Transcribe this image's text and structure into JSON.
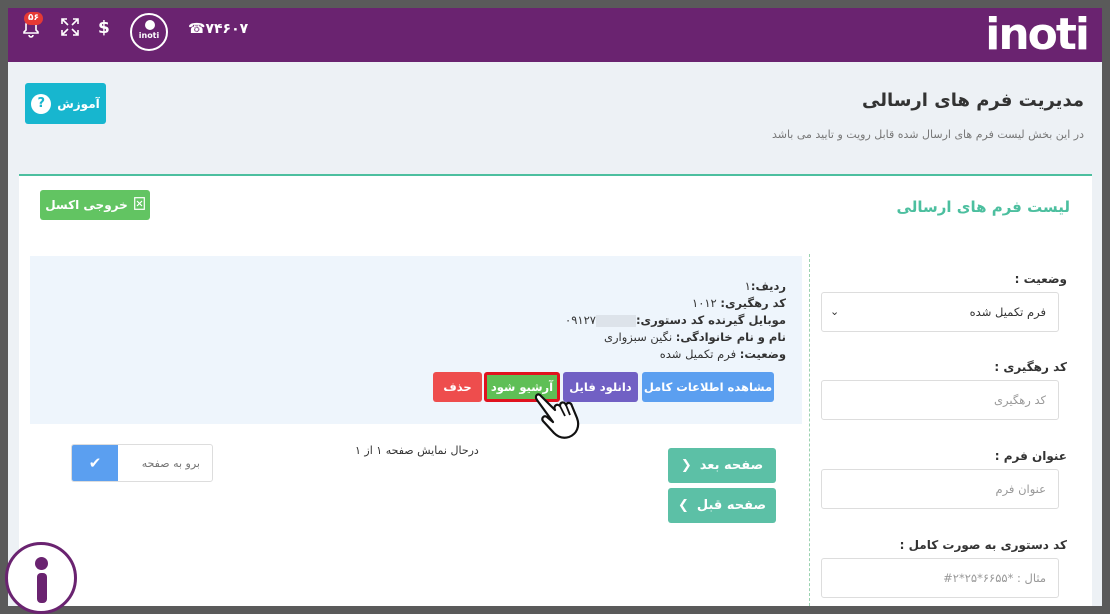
{
  "topbar": {
    "logo": "inoti",
    "notification_count": "۵۶",
    "phone": "۷۴۶۰۷",
    "dollar": "$",
    "brand_circle_text": "inoti"
  },
  "header": {
    "help_label": "آموزش",
    "title": "مدیریت فرم های ارسالی",
    "subtitle": "در این بخش لیست فرم های ارسال شده قابل رویت و تایید می باشد"
  },
  "card": {
    "title": "لیست فرم های ارسالی",
    "excel_label": "خروجی اکسل"
  },
  "record": {
    "row_label": "ردیف:",
    "row_value": "۱",
    "tracking_label": "کد رهگیری:",
    "tracking_value": "۱۰۱۲",
    "mobile_label": "موبایل گیرنده کد دستوری:",
    "mobile_value": "۰۹۱۲۷",
    "name_label": "نام و نام خانوادگی:",
    "name_value": "نگین   سبزواری",
    "status_label": "وضعیت:",
    "status_value": "فرم تکمیل شده",
    "actions": {
      "view": "مشاهده اطلاعات کامل",
      "download": "دانلود فایل",
      "archive": "آرشیو شود",
      "delete": "حذف"
    }
  },
  "pagination": {
    "goto_placeholder": "برو به صفحه",
    "info": "درحال نمایش صفحه ۱ از ۱",
    "next": "صفحه بعد",
    "prev": "صفحه قبل"
  },
  "filters": {
    "status_label": "وضعیت :",
    "status_value": "فرم تکمیل شده",
    "tracking_label": "کد رهگیری :",
    "tracking_placeholder": "کد رهگیری",
    "form_title_label": "عنوان فرم :",
    "form_title_placeholder": "عنوان فرم",
    "full_code_label": "کد دستوری به صورت کامل :",
    "full_code_placeholder": "مثال : *۶۶۵۵*۲۵*۲#"
  },
  "colors": {
    "topbar": "#6a2370",
    "accent": "#4cbf9f",
    "help": "#17b6cf",
    "archive_highlight": "#e0121f"
  }
}
